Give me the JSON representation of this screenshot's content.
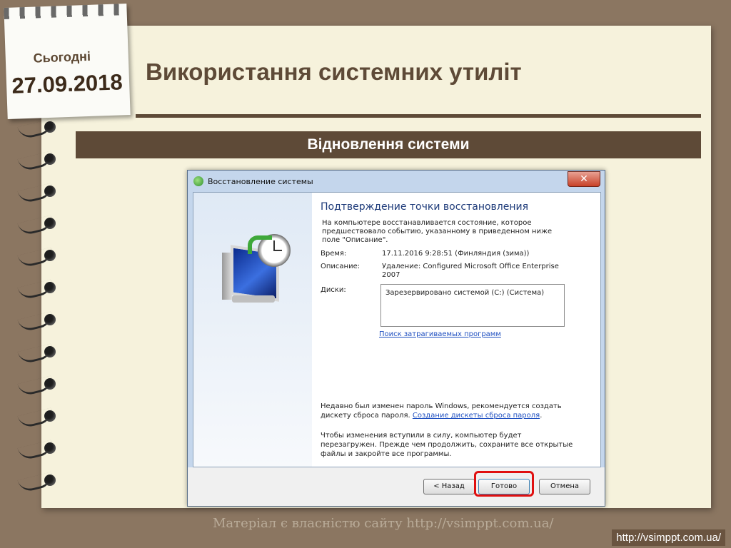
{
  "slide": {
    "today_label": "Сьогодні",
    "date": "27.09.2018",
    "title": "Використання системних утиліт",
    "subtitle": "Відновлення системи"
  },
  "dialog": {
    "window_title": "Восстановление системы",
    "close_glyph": "✕",
    "heading": "Подтверждение точки восстановления",
    "description": "На компьютере восстанавливается состояние, которое предшествовало событию, указанному в приведенном ниже поле \"Описание\".",
    "time_label": "Время:",
    "time_value": "17.11.2016 9:28:51 (Финляндия (зима))",
    "description_label": "Описание:",
    "description_value": "Удаление: Configured Microsoft Office Enterprise 2007",
    "disks_label": "Диски:",
    "disks_value": "Зарезервировано системой (C:) (Система)",
    "scan_link": "Поиск затрагиваемых программ",
    "password_note": "Недавно был изменен пароль Windows, рекомендуется создать дискету сброса пароля.",
    "password_link": "Создание дискеты сброса пароля",
    "password_note_end": ".",
    "restart_note": "Чтобы изменения вступили в силу, компьютер будет перезагружен. Прежде чем продолжить, сохраните все открытые файлы и закройте все программы.",
    "buttons": {
      "back": "< Назад",
      "done": "Готово",
      "cancel": "Отмена"
    }
  },
  "footer": {
    "watermark": "Матеріал є власністю сайту http://vsimppt.com.ua/",
    "url": "http://vsimppt.com.ua/"
  },
  "colors": {
    "background": "#8b7661",
    "paper": "#f6f2dc",
    "accent_brown": "#5e4a37",
    "highlight_red": "#e01010",
    "link_blue": "#1e4fc0"
  }
}
